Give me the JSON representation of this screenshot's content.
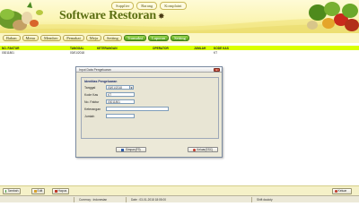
{
  "header": {
    "title": "Software Restoran",
    "top_links": [
      "Supplier",
      "Barang",
      "Komplaint"
    ]
  },
  "menu": {
    "items": [
      {
        "label": "Bahan",
        "green": false
      },
      {
        "label": "Menu",
        "green": false
      },
      {
        "label": "Member",
        "green": false
      },
      {
        "label": "Pemakai",
        "green": false
      },
      {
        "label": "Meja",
        "green": false
      },
      {
        "label": "Setting",
        "green": false
      },
      {
        "label": "Transaksi",
        "green": true
      },
      {
        "label": "Laporan",
        "green": true
      },
      {
        "label": "Setting",
        "green": true
      }
    ]
  },
  "table": {
    "columns": [
      "NO. FAKTUR",
      "TANGGAL",
      "KETERANGAN",
      "OPERATOR",
      "JUMLAH",
      "KODE KAS"
    ],
    "rows": [
      [
        "03011801",
        "03/01/2018",
        "",
        "",
        "",
        "KT"
      ]
    ]
  },
  "dialog": {
    "title": "Input Data Pengeluaran",
    "close_label": "x",
    "group_title": "Identitas Pengeluaran",
    "fields": {
      "tanggal": {
        "label": "Tanggal",
        "value": "03/01/2018"
      },
      "kode_kas": {
        "label": "Kode Kas",
        "value": "KT"
      },
      "no_faktur": {
        "label": "No. Faktur",
        "value": "03011801"
      },
      "keterangan": {
        "label": "Keterangan",
        "value": ""
      },
      "jumlah": {
        "label": "Jumlah",
        "value": ""
      }
    },
    "save_label": "Simpan(F9)",
    "cancel_label": "Keluar(ESC)"
  },
  "toolbar": {
    "add_label": "Tambah",
    "edit_label": "Edit",
    "delete_label": "Hapus",
    "exit_label": "Keluar"
  },
  "status": {
    "left": "",
    "currency": "Currency : Indonesian",
    "date": "Date : 03-01-2018 18:05:00",
    "shift": "Shift dauloty"
  },
  "colors": {
    "header_bg": "#fbf5b4",
    "brand_green": "#5a6e12",
    "table_header": "#d9ff00"
  }
}
